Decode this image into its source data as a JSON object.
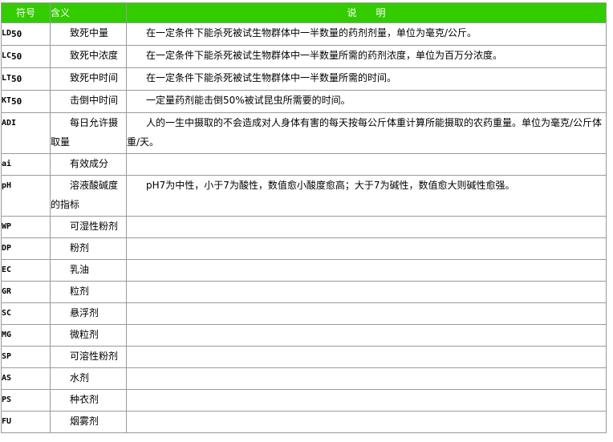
{
  "header": {
    "symbol": "符号",
    "meaning": "含义",
    "description": "说　　明"
  },
  "rows": [
    {
      "sym": "LD",
      "sub": "50",
      "meaning": "致死中量",
      "desc": "在一定条件下能杀死被试生物群体中一半数量的药剂剂量，单位为毫克/公斤。"
    },
    {
      "sym": "LC",
      "sub": "50",
      "meaning": "致死中浓度",
      "desc": "在一定条件下能杀死被试生物群体中一半数量所需的药剂浓度，单位为百万分浓度。"
    },
    {
      "sym": "LT",
      "sub": "50",
      "meaning": "致死中时间",
      "desc": "在一定条件下能杀死被试生物群体中一半数量所需的时间。"
    },
    {
      "sym": "KT",
      "sub": "50",
      "meaning": "击倒中时间",
      "desc": "一定量药剂能击倒50%被试昆虫所需要的时间。"
    },
    {
      "sym": "ADI",
      "sub": "",
      "meaning": "每日允许摄取量",
      "desc": "人的一生中摄取的不会造成对人身体有害的每天按每公斤体重计算所能摄取的农药重量。单位为毫克/公斤体重/天。"
    },
    {
      "sym": "ai",
      "sub": "",
      "meaning": "有效成分",
      "desc": ""
    },
    {
      "sym": "pH",
      "sub": "",
      "meaning": "溶液酸碱度的指标",
      "desc": "pH7为中性，小于7为酸性，数值愈小酸度愈高；大于7为碱性，数值愈大则碱性愈强。"
    },
    {
      "sym": "WP",
      "sub": "",
      "meaning": "可湿性粉剂",
      "desc": ""
    },
    {
      "sym": "DP",
      "sub": "",
      "meaning": "粉剂",
      "desc": ""
    },
    {
      "sym": "EC",
      "sub": "",
      "meaning": "乳油",
      "desc": ""
    },
    {
      "sym": "GR",
      "sub": "",
      "meaning": "粒剂",
      "desc": ""
    },
    {
      "sym": "SC",
      "sub": "",
      "meaning": "悬浮剂",
      "desc": ""
    },
    {
      "sym": "MG",
      "sub": "",
      "meaning": "微粒剂",
      "desc": ""
    },
    {
      "sym": "SP",
      "sub": "",
      "meaning": "可溶性粉剂",
      "desc": ""
    },
    {
      "sym": "AS",
      "sub": "",
      "meaning": "水剂",
      "desc": ""
    },
    {
      "sym": "PS",
      "sub": "",
      "meaning": "种衣剂",
      "desc": ""
    },
    {
      "sym": "FU",
      "sub": "",
      "meaning": "烟雾剂",
      "desc": ""
    }
  ],
  "colors": {
    "header_bg": "#33cc00",
    "header_text": "#ffffff",
    "border": "#9a9a9a"
  }
}
